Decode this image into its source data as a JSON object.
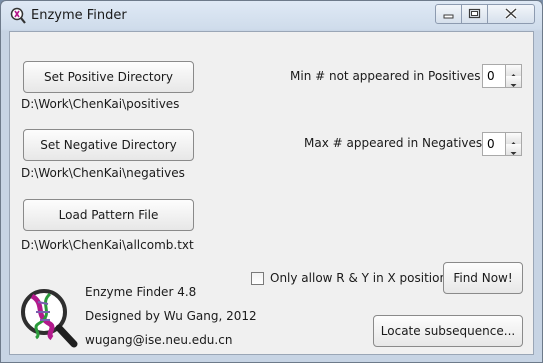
{
  "window": {
    "title": "Enzyme Finder",
    "controls": {
      "minimize": "minimize-icon",
      "maximize": "maximize-icon",
      "close": "close-icon"
    }
  },
  "positive": {
    "button": "Set Positive Directory",
    "path": "D:\\Work\\ChenKai\\positives"
  },
  "negative": {
    "button": "Set Negative Directory",
    "path": "D:\\Work\\ChenKai\\negatives"
  },
  "pattern": {
    "button": "Load Pattern File",
    "path": "D:\\Work\\ChenKai\\allcomb.txt"
  },
  "min_positives": {
    "label": "Min # not appeared in Positives",
    "value": "0"
  },
  "max_negatives": {
    "label": "Max # appeared in Negatives",
    "value": "0"
  },
  "option": {
    "label": "Only allow R & Y in X position",
    "checked": false
  },
  "actions": {
    "find": "Find Now!",
    "locate": "Locate subsequence..."
  },
  "about": {
    "name": "Enzyme Finder 4.8",
    "author": "Designed by Wu Gang, 2012",
    "email": "wugang@ise.neu.edu.cn"
  },
  "colors": {
    "window_frame": "#cfdceb",
    "client_bg": "#f0f0f0",
    "close_hover": "#c75050"
  }
}
